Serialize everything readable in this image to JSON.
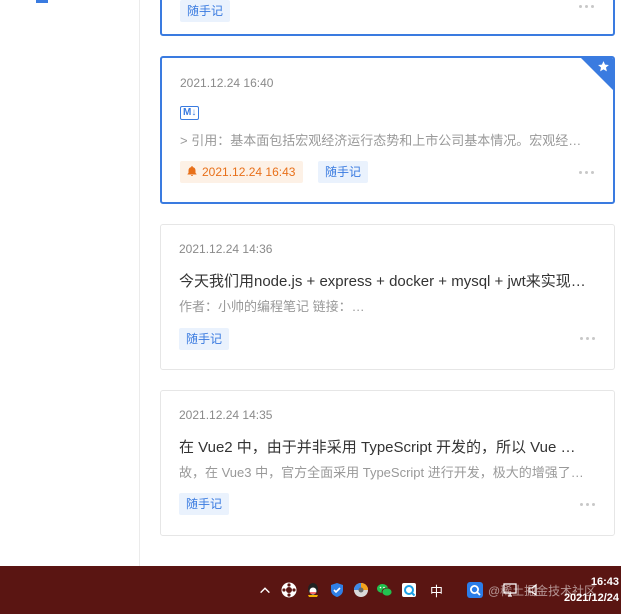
{
  "notes": [
    {
      "tag": "随手记"
    },
    {
      "date": "2021.12.24 16:40",
      "badge": "M↓",
      "excerpt": "> 引用：基本面包括宏观经济运行态势和上市公司基本情况。宏观经济运行态势反映出上市公司整体经营业绩",
      "reminder": "2021.12.24 16:43",
      "tag": "随手记"
    },
    {
      "date": "2021.12.24 14:36",
      "title": "今天我们用node.js + express + docker + mysql + jwt来实现一个完整的项目",
      "excerpt": "作者：小帅的编程笔记 链接：…",
      "tag": "随手记"
    },
    {
      "date": "2021.12.24 14:35",
      "title": "在 Vue2 中，由于并非采用 TypeScript 开发的，所以 Vue 的类型推导",
      "excerpt": "故，在 Vue3 中，官方全面采用 TypeScript 进行开发，极大的增强了类型推导能力",
      "tag": "随手记"
    }
  ],
  "taskbar": {
    "ime": "中",
    "watermark": "@稀土掘金技术社区",
    "time": "16:43",
    "date": "2021/12/24"
  },
  "colors": {
    "accent": "#3a7be0",
    "reminder": "#e8701a",
    "taskbar": "#5a1512"
  }
}
